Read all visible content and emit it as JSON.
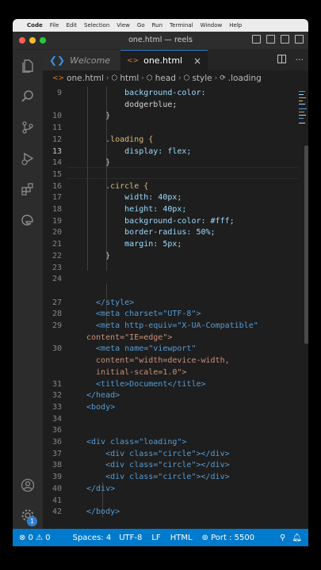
{
  "menubar": {
    "app": "Code",
    "items": [
      "File",
      "Edit",
      "Selection",
      "View",
      "Go",
      "Run",
      "Terminal",
      "Window",
      "Help"
    ]
  },
  "window": {
    "title": "one.html — reels"
  },
  "tabs": [
    {
      "label": "Welcome"
    },
    {
      "label": "one.html"
    }
  ],
  "breadcrumb": [
    "one.html",
    "html",
    "head",
    "style",
    ".loading"
  ],
  "status": {
    "problems": "⊗ 0 ⚠ 0",
    "spaces": "Spaces: 4",
    "encoding": "UTF-8",
    "eol": "LF",
    "language": "HTML",
    "port": "Port : 5500"
  },
  "notifications_badge": "1",
  "code_lines": [
    {
      "n": "9",
      "text": "        background-color:"
    },
    {
      "n": "",
      "text": "        dodgerblue;"
    },
    {
      "n": "10",
      "text": "    }"
    },
    {
      "n": "11",
      "text": ""
    },
    {
      "n": "12",
      "text": "    .loading {"
    },
    {
      "n": "13",
      "text": "        display: flex;"
    },
    {
      "n": "14",
      "text": "    }"
    },
    {
      "n": "15",
      "text": ""
    },
    {
      "n": "16",
      "text": "    .circle {"
    },
    {
      "n": "17",
      "text": "        width: 40px;"
    },
    {
      "n": "18",
      "text": "        height: 40px;"
    },
    {
      "n": "19",
      "text": "        background-color: #fff;"
    },
    {
      "n": "20",
      "text": "        border-radius: 50%;"
    },
    {
      "n": "21",
      "text": "        margin: 5px;"
    },
    {
      "n": "22",
      "text": "    }"
    },
    {
      "n": "23",
      "text": ""
    },
    {
      "n": "24",
      "text": ""
    },
    {
      "n": "",
      "text": ""
    },
    {
      "n": "27",
      "text": "  </style>"
    },
    {
      "n": "28",
      "text": "  <meta charset=\"UTF-8\">"
    },
    {
      "n": "29",
      "text": "  <meta http-equiv=\"X-UA-Compatible\""
    },
    {
      "n": "",
      "text": "content=\"IE=edge\">"
    },
    {
      "n": "30",
      "text": "  <meta name=\"viewport\""
    },
    {
      "n": "",
      "text": "  content=\"width=device-width,"
    },
    {
      "n": "",
      "text": "  initial-scale=1.0\">"
    },
    {
      "n": "31",
      "text": "  <title>Document</title>"
    },
    {
      "n": "32",
      "text": "</head>"
    },
    {
      "n": "33",
      "text": "<body>"
    },
    {
      "n": "34",
      "text": ""
    },
    {
      "n": "36",
      "text": ""
    },
    {
      "n": "36",
      "text": "<div class=\"loading\">"
    },
    {
      "n": "37",
      "text": "    <div class=\"circle\"></div>"
    },
    {
      "n": "38",
      "text": "    <div class=\"circle\"></div>"
    },
    {
      "n": "39",
      "text": "    <div class=\"circle\"></div>"
    },
    {
      "n": "40",
      "text": "</div>"
    },
    {
      "n": "41",
      "text": ""
    },
    {
      "n": "42",
      "text": "</body>"
    }
  ]
}
